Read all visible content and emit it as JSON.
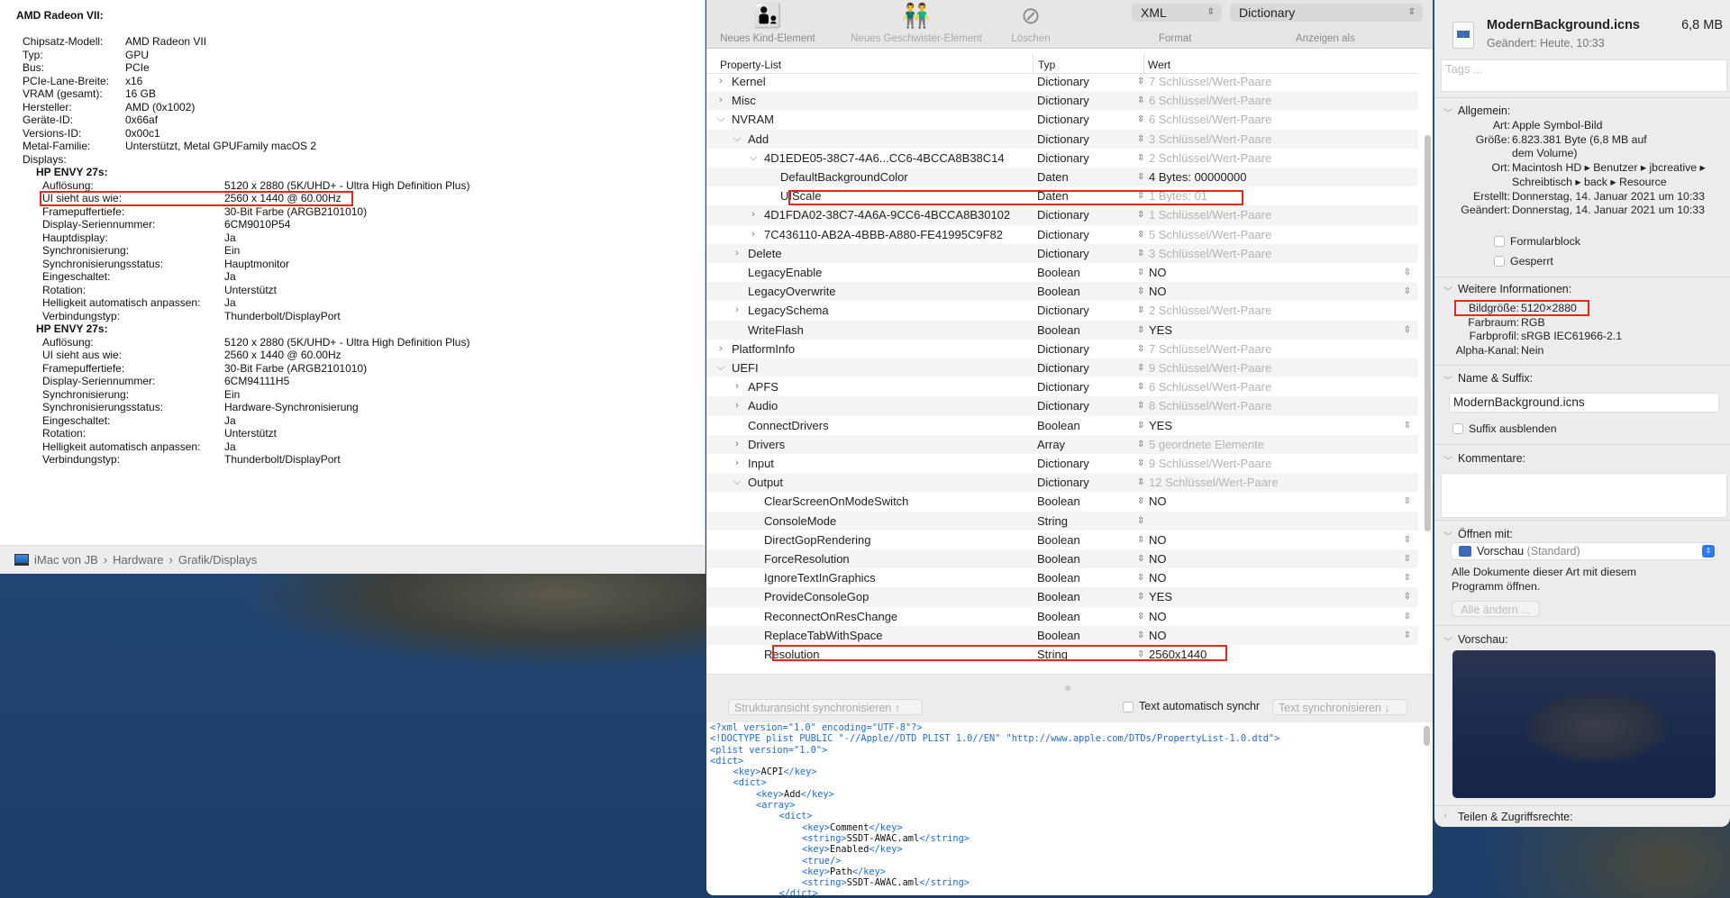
{
  "sysinfo": {
    "title": "AMD Radeon VII:",
    "gpu": [
      [
        "Chipsatz-Modell:",
        "AMD Radeon VII"
      ],
      [
        "Typ:",
        "GPU"
      ],
      [
        "Bus:",
        "PCIe"
      ],
      [
        "PCIe-Lane-Breite:",
        "x16"
      ],
      [
        "VRAM (gesamt):",
        "16 GB"
      ],
      [
        "Hersteller:",
        "AMD (0x1002)"
      ],
      [
        "Geräte-ID:",
        "0x66af"
      ],
      [
        "Versions-ID:",
        "0x00c1"
      ],
      [
        "Metal-Familie:",
        "Unterstützt, Metal GPUFamily macOS 2"
      ]
    ],
    "displays_label": "Displays:",
    "displays": [
      {
        "name": "HP ENVY 27s:",
        "rows": [
          [
            "Auflösung:",
            "5120 x 2880 (5K/UHD+ - Ultra High Definition Plus)"
          ],
          [
            "UI sieht aus wie:",
            "2560 x 1440 @ 60.00Hz"
          ],
          [
            "Framepuffertiefe:",
            "30-Bit Farbe (ARGB2101010)"
          ],
          [
            "Display-Seriennummer:",
            "6CM9010P54"
          ],
          [
            "Hauptdisplay:",
            "Ja"
          ],
          [
            "Synchronisierung:",
            "Ein"
          ],
          [
            "Synchronisierungsstatus:",
            "Hauptmonitor"
          ],
          [
            "Eingeschaltet:",
            "Ja"
          ],
          [
            "Rotation:",
            "Unterstützt"
          ],
          [
            "Helligkeit automatisch anpassen:",
            "Ja"
          ],
          [
            "Verbindungstyp:",
            "Thunderbolt/DisplayPort"
          ]
        ]
      },
      {
        "name": "HP ENVY 27s:",
        "rows": [
          [
            "Auflösung:",
            "5120 x 2880 (5K/UHD+ - Ultra High Definition Plus)"
          ],
          [
            "UI sieht aus wie:",
            "2560 x 1440 @ 60.00Hz"
          ],
          [
            "Framepuffertiefe:",
            "30-Bit Farbe (ARGB2101010)"
          ],
          [
            "Display-Seriennummer:",
            "6CM94111H5"
          ],
          [
            "Synchronisierung:",
            "Ein"
          ],
          [
            "Synchronisierungsstatus:",
            "Hardware-Synchronisierung"
          ],
          [
            "Eingeschaltet:",
            "Ja"
          ],
          [
            "Rotation:",
            "Unterstützt"
          ],
          [
            "Helligkeit automatisch anpassen:",
            "Ja"
          ],
          [
            "Verbindungstyp:",
            "Thunderbolt/DisplayPort"
          ]
        ]
      }
    ],
    "breadcrumb": [
      "iMac von JB",
      "Hardware",
      "Grafik/Displays"
    ]
  },
  "plist": {
    "toolbar": {
      "new_child": "Neues Kind-Element",
      "new_sibling": "Neues Geschwister-Element",
      "delete": "Löschen",
      "format_value": "XML",
      "format_label": "Format",
      "view_value": "Dictionary",
      "view_label": "Anzeigen als"
    },
    "columns": [
      "Property-List",
      "Typ",
      "Wert"
    ],
    "rows": [
      {
        "name": "Kernel",
        "level": 0,
        "exp": "closed",
        "type": "Dictionary",
        "value": "7 Schlüssel/Wert-Paare",
        "gray": true
      },
      {
        "name": "Misc",
        "level": 0,
        "exp": "closed",
        "type": "Dictionary",
        "value": "6 Schlüssel/Wert-Paare",
        "gray": true
      },
      {
        "name": "NVRAM",
        "level": 0,
        "exp": "open",
        "type": "Dictionary",
        "value": "6 Schlüssel/Wert-Paare",
        "gray": true
      },
      {
        "name": "Add",
        "level": 1,
        "exp": "open",
        "type": "Dictionary",
        "value": "3 Schlüssel/Wert-Paare",
        "gray": true
      },
      {
        "name": "4D1EDE05-38C7-4A6...CC6-4BCCA8B38C14",
        "level": 2,
        "exp": "open",
        "type": "Dictionary",
        "value": "2 Schlüssel/Wert-Paare",
        "gray": true
      },
      {
        "name": "DefaultBackgroundColor",
        "level": 3,
        "exp": "",
        "type": "Daten",
        "value": "4 Bytes: 00000000"
      },
      {
        "name": "UIScale",
        "level": 3,
        "exp": "",
        "type": "Daten",
        "value": "1 Bytes: 01",
        "gray": true,
        "highlight": true
      },
      {
        "name": "4D1FDA02-38C7-4A6A-9CC6-4BCCA8B30102",
        "level": 2,
        "exp": "closed",
        "type": "Dictionary",
        "value": "1 Schlüssel/Wert-Paare",
        "gray": true
      },
      {
        "name": "7C436110-AB2A-4BBB-A880-FE41995C9F82",
        "level": 2,
        "exp": "closed",
        "type": "Dictionary",
        "value": "5 Schlüssel/Wert-Paare",
        "gray": true
      },
      {
        "name": "Delete",
        "level": 1,
        "exp": "closed",
        "type": "Dictionary",
        "value": "3 Schlüssel/Wert-Paare",
        "gray": true
      },
      {
        "name": "LegacyEnable",
        "level": 1,
        "exp": "",
        "type": "Boolean",
        "value": "NO",
        "select": true
      },
      {
        "name": "LegacyOverwrite",
        "level": 1,
        "exp": "",
        "type": "Boolean",
        "value": "NO",
        "select": true
      },
      {
        "name": "LegacySchema",
        "level": 1,
        "exp": "closed",
        "type": "Dictionary",
        "value": "2 Schlüssel/Wert-Paare",
        "gray": true
      },
      {
        "name": "WriteFlash",
        "level": 1,
        "exp": "",
        "type": "Boolean",
        "value": "YES",
        "select": true
      },
      {
        "name": "PlatformInfo",
        "level": 0,
        "exp": "closed",
        "type": "Dictionary",
        "value": "7 Schlüssel/Wert-Paare",
        "gray": true
      },
      {
        "name": "UEFI",
        "level": 0,
        "exp": "open",
        "type": "Dictionary",
        "value": "9 Schlüssel/Wert-Paare",
        "gray": true
      },
      {
        "name": "APFS",
        "level": 1,
        "exp": "closed",
        "type": "Dictionary",
        "value": "6 Schlüssel/Wert-Paare",
        "gray": true
      },
      {
        "name": "Audio",
        "level": 1,
        "exp": "closed",
        "type": "Dictionary",
        "value": "8 Schlüssel/Wert-Paare",
        "gray": true
      },
      {
        "name": "ConnectDrivers",
        "level": 1,
        "exp": "",
        "type": "Boolean",
        "value": "YES",
        "select": true
      },
      {
        "name": "Drivers",
        "level": 1,
        "exp": "closed",
        "type": "Array",
        "value": "5 geordnete Elemente",
        "gray": true
      },
      {
        "name": "Input",
        "level": 1,
        "exp": "closed",
        "type": "Dictionary",
        "value": "9 Schlüssel/Wert-Paare",
        "gray": true
      },
      {
        "name": "Output",
        "level": 1,
        "exp": "open",
        "type": "Dictionary",
        "value": "12 Schlüssel/Wert-Paare",
        "gray": true
      },
      {
        "name": "ClearScreenOnModeSwitch",
        "level": 2,
        "exp": "",
        "type": "Boolean",
        "value": "NO",
        "select": true
      },
      {
        "name": "ConsoleMode",
        "level": 2,
        "exp": "",
        "type": "String",
        "value": ""
      },
      {
        "name": "DirectGopRendering",
        "level": 2,
        "exp": "",
        "type": "Boolean",
        "value": "NO",
        "select": true
      },
      {
        "name": "ForceResolution",
        "level": 2,
        "exp": "",
        "type": "Boolean",
        "value": "NO",
        "select": true
      },
      {
        "name": "IgnoreTextInGraphics",
        "level": 2,
        "exp": "",
        "type": "Boolean",
        "value": "NO",
        "select": true
      },
      {
        "name": "ProvideConsoleGop",
        "level": 2,
        "exp": "",
        "type": "Boolean",
        "value": "YES",
        "select": true
      },
      {
        "name": "ReconnectOnResChange",
        "level": 2,
        "exp": "",
        "type": "Boolean",
        "value": "NO",
        "select": true
      },
      {
        "name": "ReplaceTabWithSpace",
        "level": 2,
        "exp": "",
        "type": "Boolean",
        "value": "NO",
        "select": true
      },
      {
        "name": "Resolution",
        "level": 2,
        "exp": "",
        "type": "String",
        "value": "2560x1440",
        "highlight": true
      }
    ],
    "sync_structure": "Strukturansicht synchronisieren ↑",
    "auto_sync": "Text automatisch synchr",
    "sync_text": "Text synchronisieren ↓",
    "xml": [
      {
        "i": 0,
        "t": [
          [
            "t",
            "<?xml version=\"1.0\" encoding=\"UTF-8\"?>"
          ]
        ]
      },
      {
        "i": 0,
        "t": [
          [
            "t",
            "<!DOCTYPE plist PUBLIC \"-//Apple//DTD PLIST 1.0//EN\" \"http://www.apple.com/DTDs/PropertyList-1.0.dtd\">"
          ]
        ]
      },
      {
        "i": 0,
        "t": [
          [
            "t",
            "<plist version=\"1.0\">"
          ]
        ]
      },
      {
        "i": 0,
        "t": [
          [
            "t",
            "<dict>"
          ]
        ]
      },
      {
        "i": 1,
        "t": [
          [
            "t",
            "<key>"
          ],
          [
            "v",
            "ACPI"
          ],
          [
            "t",
            "</key>"
          ]
        ]
      },
      {
        "i": 1,
        "t": [
          [
            "t",
            "<dict>"
          ]
        ]
      },
      {
        "i": 2,
        "t": [
          [
            "t",
            "<key>"
          ],
          [
            "v",
            "Add"
          ],
          [
            "t",
            "</key>"
          ]
        ]
      },
      {
        "i": 2,
        "t": [
          [
            "t",
            "<array>"
          ]
        ]
      },
      {
        "i": 3,
        "t": [
          [
            "t",
            "<dict>"
          ]
        ]
      },
      {
        "i": 4,
        "t": [
          [
            "t",
            "<key>"
          ],
          [
            "v",
            "Comment"
          ],
          [
            "t",
            "</key>"
          ]
        ]
      },
      {
        "i": 4,
        "t": [
          [
            "t",
            "<string>"
          ],
          [
            "v",
            "SSDT-AWAC.aml"
          ],
          [
            "t",
            "</string>"
          ]
        ]
      },
      {
        "i": 4,
        "t": [
          [
            "t",
            "<key>"
          ],
          [
            "v",
            "Enabled"
          ],
          [
            "t",
            "</key>"
          ]
        ]
      },
      {
        "i": 4,
        "t": [
          [
            "t",
            "<true/>"
          ]
        ]
      },
      {
        "i": 4,
        "t": [
          [
            "t",
            "<key>"
          ],
          [
            "v",
            "Path"
          ],
          [
            "t",
            "</key>"
          ]
        ]
      },
      {
        "i": 4,
        "t": [
          [
            "t",
            "<string>"
          ],
          [
            "v",
            "SSDT-AWAC.aml"
          ],
          [
            "t",
            "</string>"
          ]
        ]
      },
      {
        "i": 3,
        "t": [
          [
            "t",
            "</dict>"
          ]
        ]
      }
    ]
  },
  "info": {
    "file_name": "ModernBackground.icns",
    "file_size": "6,8 MB",
    "modified": "Geändert: Heute, 10:33",
    "tags_placeholder": "Tags ...",
    "general_title": "Allgemein:",
    "general": [
      [
        "Art:",
        "Apple Symbol-Bild"
      ],
      [
        "Größe:",
        "6.823.381 Byte (6,8 MB auf"
      ],
      [
        "",
        "dem Volume)"
      ],
      [
        "Ort:",
        "Macintosh HD ▸ Benutzer ▸ jbcreative ▸"
      ],
      [
        "",
        "Schreibtisch ▸ back ▸ Resource"
      ],
      [
        "Erstellt:",
        "Donnerstag, 14. Januar 2021 um 10:33"
      ],
      [
        "Geändert:",
        "Donnerstag, 14. Januar 2021 um 10:33"
      ]
    ],
    "formularblock": "Formularblock",
    "gesperrt": "Gesperrt",
    "more_title": "Weitere Informationen:",
    "more": [
      [
        "Bildgröße:",
        "5120×2880"
      ],
      [
        "Farbraum:",
        "RGB"
      ],
      [
        "Farbprofil:",
        "sRGB IEC61966-2.1"
      ],
      [
        "Alpha-Kanal:",
        "Nein"
      ]
    ],
    "name_title": "Name & Suffix:",
    "name_value": "ModernBackground.icns",
    "hide_suffix": "Suffix ausblenden",
    "comments_title": "Kommentare:",
    "open_title": "Öffnen mit:",
    "open_app": "Vorschau",
    "open_default": "(Standard)",
    "open_desc": "Alle Dokumente dieser Art mit diesem",
    "open_desc2": "Programm öffnen.",
    "change_all": "Alle ändern ...",
    "preview_title": "Vorschau:",
    "share_title": "Teilen & Zugriffsrechte:"
  }
}
